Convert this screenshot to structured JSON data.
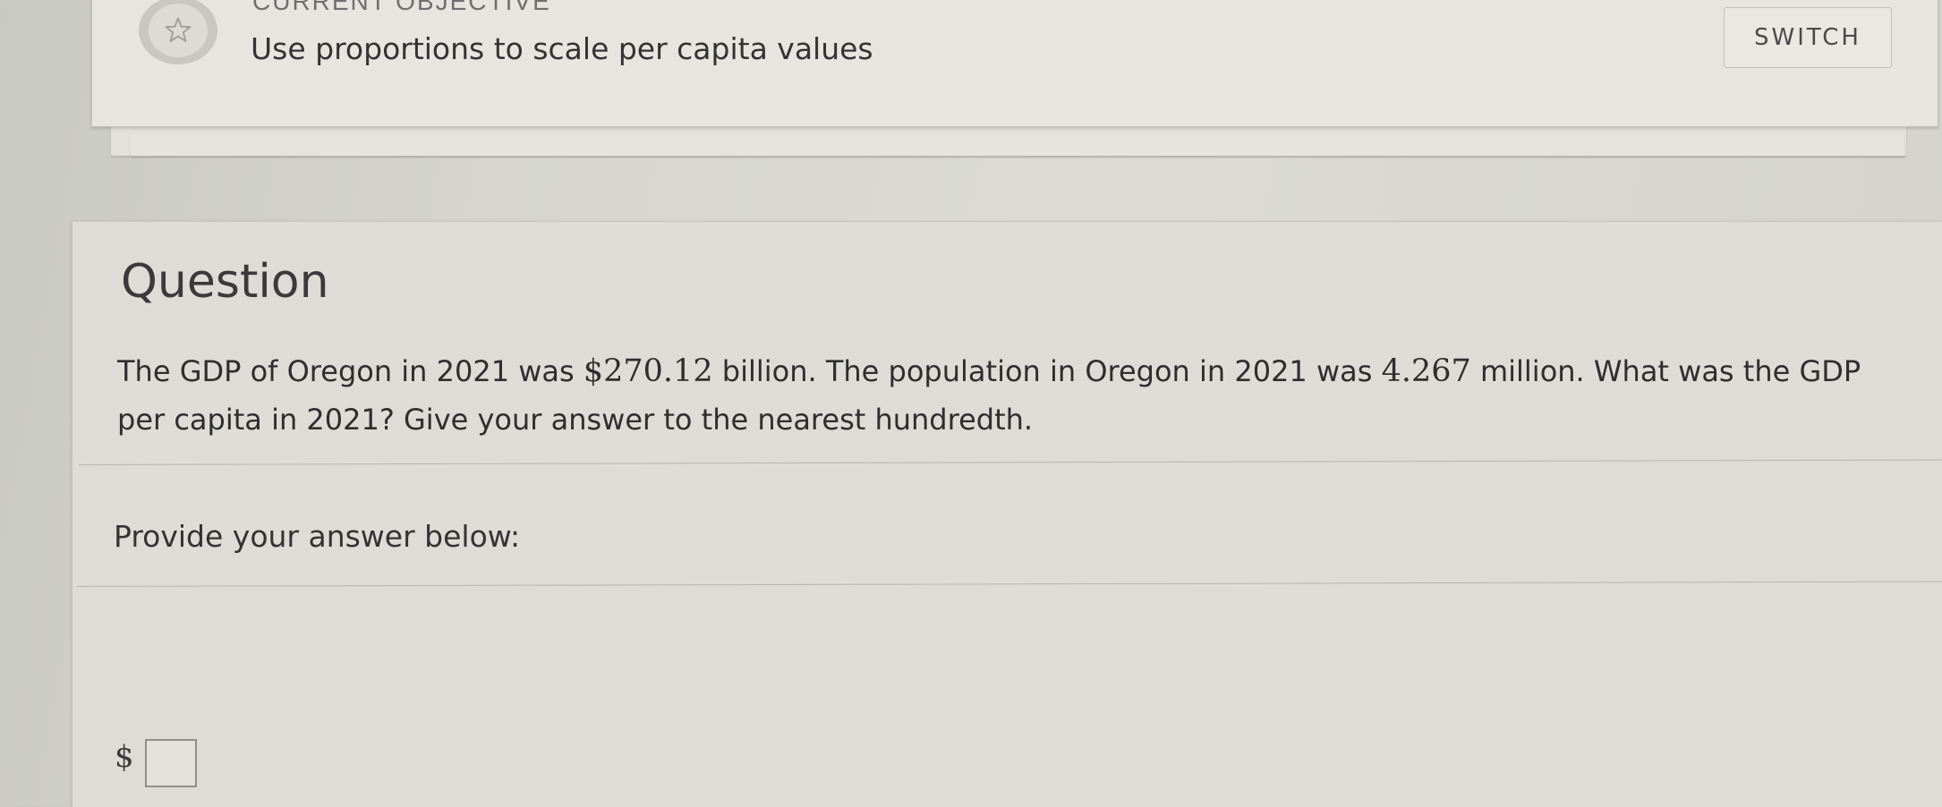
{
  "objective": {
    "heading": "CURRENT OBJECTIVE",
    "text": "Use proportions to scale per capita values",
    "switch_label": "SWITCH",
    "icon": "star-icon"
  },
  "question": {
    "heading": "Question",
    "body": {
      "part1": "The GDP of Oregon in 2021 was ",
      "gdp": "$270.12",
      "part2": " billion. The population in Oregon in 2021 was ",
      "population": "4.267",
      "part3": " million. What was the GDP per capita in 2021? Give your answer to the nearest hundredth."
    }
  },
  "answer": {
    "label": "Provide your answer below:",
    "currency_symbol": "$",
    "value": ""
  }
}
